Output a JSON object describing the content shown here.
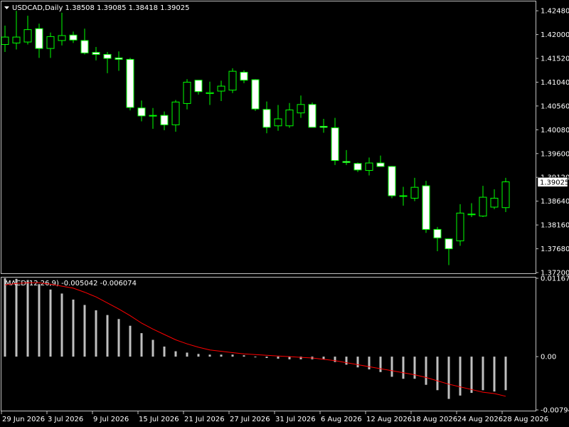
{
  "header": {
    "symbol_line": "USDCAD,Daily  1.38508 1.39085 1.38418 1.39025"
  },
  "macd": {
    "title": "MACD(12,26,9) -0.005042 -0.006074"
  },
  "colors": {
    "background": "#000000",
    "axis": "#c0c0c0",
    "bull_fill": "#000000",
    "bear_fill": "#ffffff",
    "wick": "#00ff00",
    "histogram": "#c0c0c0",
    "signal": "#ff0000",
    "text": "#ffffff"
  },
  "chart_data": [
    {
      "type": "candlestick",
      "title": "USDCAD,Daily",
      "y_ticks": [
        "1.42480",
        "1.42000",
        "1.41520",
        "1.41040",
        "1.40560",
        "1.40080",
        "1.39600",
        "1.39120",
        "1.38640",
        "1.38160",
        "1.37680",
        "1.37200"
      ],
      "ylim": [
        1.372,
        1.4264
      ],
      "current_price": "1.39025",
      "x_ticks": [
        {
          "index": 0,
          "label": "29 Jun 2026"
        },
        {
          "index": 4,
          "label": "3 Jul 2026"
        },
        {
          "index": 8,
          "label": "9 Jul 2026"
        },
        {
          "index": 12,
          "label": "15 Jul 2026"
        },
        {
          "index": 16,
          "label": "21 Jul 2026"
        },
        {
          "index": 20,
          "label": "27 Jul 2026"
        },
        {
          "index": 24,
          "label": "31 Jul 2026"
        },
        {
          "index": 28,
          "label": "6 Aug 2026"
        },
        {
          "index": 32,
          "label": "12 Aug 2026"
        },
        {
          "index": 36,
          "label": "18 Aug 2026"
        },
        {
          "index": 40,
          "label": "24 Aug 2026"
        },
        {
          "index": 44,
          "label": "28 Aug 2026"
        }
      ],
      "candles": [
        {
          "o": 1.418,
          "h": 1.4218,
          "l": 1.4165,
          "c": 1.4195
        },
        {
          "o": 1.4183,
          "h": 1.4248,
          "l": 1.417,
          "c": 1.4195
        },
        {
          "o": 1.4185,
          "h": 1.4238,
          "l": 1.418,
          "c": 1.421
        },
        {
          "o": 1.4212,
          "h": 1.4222,
          "l": 1.4153,
          "c": 1.4172
        },
        {
          "o": 1.4172,
          "h": 1.4204,
          "l": 1.4153,
          "c": 1.4196
        },
        {
          "o": 1.4188,
          "h": 1.4244,
          "l": 1.4178,
          "c": 1.4198
        },
        {
          "o": 1.4199,
          "h": 1.4206,
          "l": 1.4183,
          "c": 1.4189
        },
        {
          "o": 1.4188,
          "h": 1.4212,
          "l": 1.416,
          "c": 1.4163
        },
        {
          "o": 1.4164,
          "h": 1.4175,
          "l": 1.4148,
          "c": 1.416
        },
        {
          "o": 1.416,
          "h": 1.4165,
          "l": 1.4122,
          "c": 1.4152
        },
        {
          "o": 1.4153,
          "h": 1.4166,
          "l": 1.4127,
          "c": 1.415
        },
        {
          "o": 1.415,
          "h": 1.4153,
          "l": 1.4047,
          "c": 1.4053
        },
        {
          "o": 1.4052,
          "h": 1.4067,
          "l": 1.4025,
          "c": 1.4036
        },
        {
          "o": 1.4037,
          "h": 1.4052,
          "l": 1.401,
          "c": 1.4036
        },
        {
          "o": 1.4037,
          "h": 1.4045,
          "l": 1.4007,
          "c": 1.4018
        },
        {
          "o": 1.4018,
          "h": 1.4068,
          "l": 1.4004,
          "c": 1.4064
        },
        {
          "o": 1.4061,
          "h": 1.411,
          "l": 1.4049,
          "c": 1.4104
        },
        {
          "o": 1.4108,
          "h": 1.4108,
          "l": 1.4079,
          "c": 1.4085
        },
        {
          "o": 1.4081,
          "h": 1.4105,
          "l": 1.4058,
          "c": 1.4083
        },
        {
          "o": 1.4086,
          "h": 1.4107,
          "l": 1.4066,
          "c": 1.4096
        },
        {
          "o": 1.4088,
          "h": 1.4132,
          "l": 1.4082,
          "c": 1.4126
        },
        {
          "o": 1.4124,
          "h": 1.4128,
          "l": 1.4102,
          "c": 1.4108
        },
        {
          "o": 1.4109,
          "h": 1.411,
          "l": 1.4046,
          "c": 1.405
        },
        {
          "o": 1.4049,
          "h": 1.4065,
          "l": 1.4001,
          "c": 1.4013
        },
        {
          "o": 1.4016,
          "h": 1.4058,
          "l": 1.4006,
          "c": 1.403
        },
        {
          "o": 1.4016,
          "h": 1.4062,
          "l": 1.4012,
          "c": 1.4048
        },
        {
          "o": 1.4042,
          "h": 1.4077,
          "l": 1.4032,
          "c": 1.4059
        },
        {
          "o": 1.4059,
          "h": 1.4063,
          "l": 1.4014,
          "c": 1.4013
        },
        {
          "o": 1.4015,
          "h": 1.403,
          "l": 1.4002,
          "c": 1.4013
        },
        {
          "o": 1.4012,
          "h": 1.4032,
          "l": 1.3937,
          "c": 1.3946
        },
        {
          "o": 1.3944,
          "h": 1.3967,
          "l": 1.3937,
          "c": 1.3942
        },
        {
          "o": 1.394,
          "h": 1.3942,
          "l": 1.3923,
          "c": 1.3927
        },
        {
          "o": 1.3926,
          "h": 1.3952,
          "l": 1.3916,
          "c": 1.3941
        },
        {
          "o": 1.3941,
          "h": 1.3956,
          "l": 1.3935,
          "c": 1.3934
        },
        {
          "o": 1.3934,
          "h": 1.3935,
          "l": 1.387,
          "c": 1.3875
        },
        {
          "o": 1.3875,
          "h": 1.3893,
          "l": 1.3855,
          "c": 1.3875
        },
        {
          "o": 1.387,
          "h": 1.3911,
          "l": 1.3864,
          "c": 1.3892
        },
        {
          "o": 1.3895,
          "h": 1.3905,
          "l": 1.38,
          "c": 1.3807
        },
        {
          "o": 1.3807,
          "h": 1.3812,
          "l": 1.3763,
          "c": 1.379
        },
        {
          "o": 1.3788,
          "h": 1.3788,
          "l": 1.3735,
          "c": 1.3768
        },
        {
          "o": 1.3784,
          "h": 1.3858,
          "l": 1.3774,
          "c": 1.384
        },
        {
          "o": 1.3838,
          "h": 1.386,
          "l": 1.3832,
          "c": 1.3838
        },
        {
          "o": 1.3834,
          "h": 1.3895,
          "l": 1.3832,
          "c": 1.3872
        },
        {
          "o": 1.3852,
          "h": 1.3888,
          "l": 1.3848,
          "c": 1.387
        },
        {
          "o": 1.3851,
          "h": 1.3911,
          "l": 1.3842,
          "c": 1.3903
        }
      ]
    },
    {
      "type": "bar",
      "title": "MACD(12,26,9) -0.005042 -0.006074",
      "y_ticks": [
        "0.011676",
        "0.00",
        "-0.00794"
      ],
      "ylim": [
        -0.00794,
        0.011676
      ],
      "series": [
        {
          "name": "MACD",
          "values": [
            0.0117,
            0.0116,
            0.0114,
            0.0108,
            0.01,
            0.0094,
            0.0085,
            0.0077,
            0.0069,
            0.0062,
            0.0056,
            0.0046,
            0.0035,
            0.0025,
            0.0015,
            0.0008,
            0.0006,
            0.0004,
            0.0003,
            0.0003,
            0.0003,
            0.0002,
            0.0,
            -0.0002,
            -0.0003,
            -0.0004,
            -0.0004,
            -0.0004,
            -0.0004,
            -0.0008,
            -0.0012,
            -0.0016,
            -0.0019,
            -0.0023,
            -0.003,
            -0.0033,
            -0.0033,
            -0.0042,
            -0.005,
            -0.0063,
            -0.0058,
            -0.0054,
            -0.005,
            -0.0052,
            -0.005
          ]
        },
        {
          "name": "Signal",
          "values": [
            0.0107,
            0.0109,
            0.011,
            0.011,
            0.0108,
            0.0105,
            0.0102,
            0.0096,
            0.0089,
            0.008,
            0.0071,
            0.0061,
            0.005,
            0.0041,
            0.0033,
            0.0025,
            0.0019,
            0.0014,
            0.001,
            0.0008,
            0.0006,
            0.0004,
            0.0003,
            0.0002,
            0.0001,
            0.0,
            -0.0001,
            -0.0002,
            -0.0004,
            -0.0006,
            -0.0009,
            -0.0012,
            -0.0015,
            -0.0018,
            -0.0021,
            -0.0024,
            -0.0027,
            -0.0031,
            -0.0036,
            -0.0041,
            -0.0045,
            -0.0049,
            -0.0053,
            -0.0055,
            -0.0059
          ]
        }
      ]
    }
  ]
}
